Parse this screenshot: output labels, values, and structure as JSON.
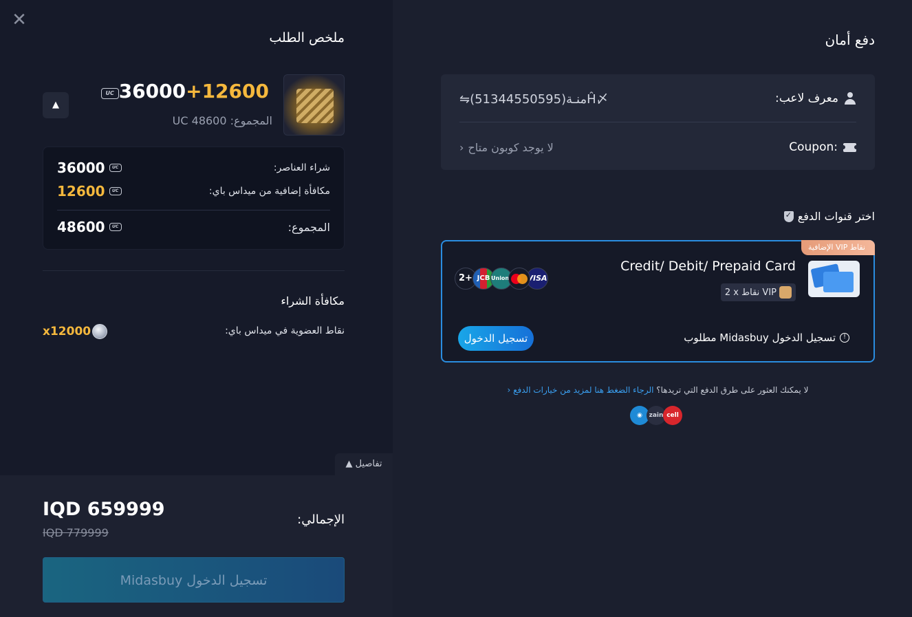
{
  "left": {
    "close_glyph": "✕",
    "summary_title": "ملخص الطلب",
    "product": {
      "base_amount": "36000",
      "plus": "+",
      "bonus_amount": "12600",
      "currency_badge": "UC",
      "total_label": "المجموع:",
      "total_value": "UC 48600"
    },
    "collapse_glyph": "▲",
    "breakdown": {
      "items_label": "شراء العناصر:",
      "items_value": "36000",
      "bonus_label": "مكافأة إضافية من ميداس باي:",
      "bonus_value": "12600",
      "total_label": "المجموع:",
      "total_value": "48600"
    },
    "reward": {
      "title": "مكافأة الشراء",
      "label": "نقاط العضوية في ميداس باي:",
      "value": "x12000"
    },
    "details_tab": "تفاصيل ▲",
    "bottom": {
      "grand_label": "الإجمالي:",
      "grand_price": "IQD 659999",
      "old_price": "IQD 779999",
      "login_button": "تسجيل الدخول Midasbuy"
    }
  },
  "right": {
    "secure_title": "دفع أمان",
    "player": {
      "label": "معرف لاعب:",
      "value": "⇋(51344550595)ﻣﻨـﺔĤ〆"
    },
    "coupon": {
      "label": "Coupon:",
      "value": "لا يوجد كوبون متاح",
      "chevron": "‹"
    },
    "channels_title": "اختر قنوات الدفع",
    "card": {
      "ribbon": "نقاط VIP الإضافية",
      "name": "Credit/ Debit/ Prepaid Card",
      "vip_pill": "2 x نقاط VIP",
      "logos": [
        "2+",
        "JCB",
        "UnionPay",
        "",
        "VISA"
      ],
      "login_required": "تسجيل الدخول Midasbuy مطلوب",
      "login_button": "تسجيل الدخول"
    },
    "more_options": {
      "text": "لا يمكنك العثور على طرق الدفع التي تريدها؟",
      "link": "الرجاء الضغط هنا لمزيد من خيارات الدفع ‹"
    },
    "wallets": [
      "",
      "zain",
      "cell"
    ]
  },
  "colors": {
    "accent_blue": "#2a8de0",
    "bonus_gold": "#f5b83d",
    "left_bg": "#161a29",
    "right_bg": "#1b1f2e"
  }
}
